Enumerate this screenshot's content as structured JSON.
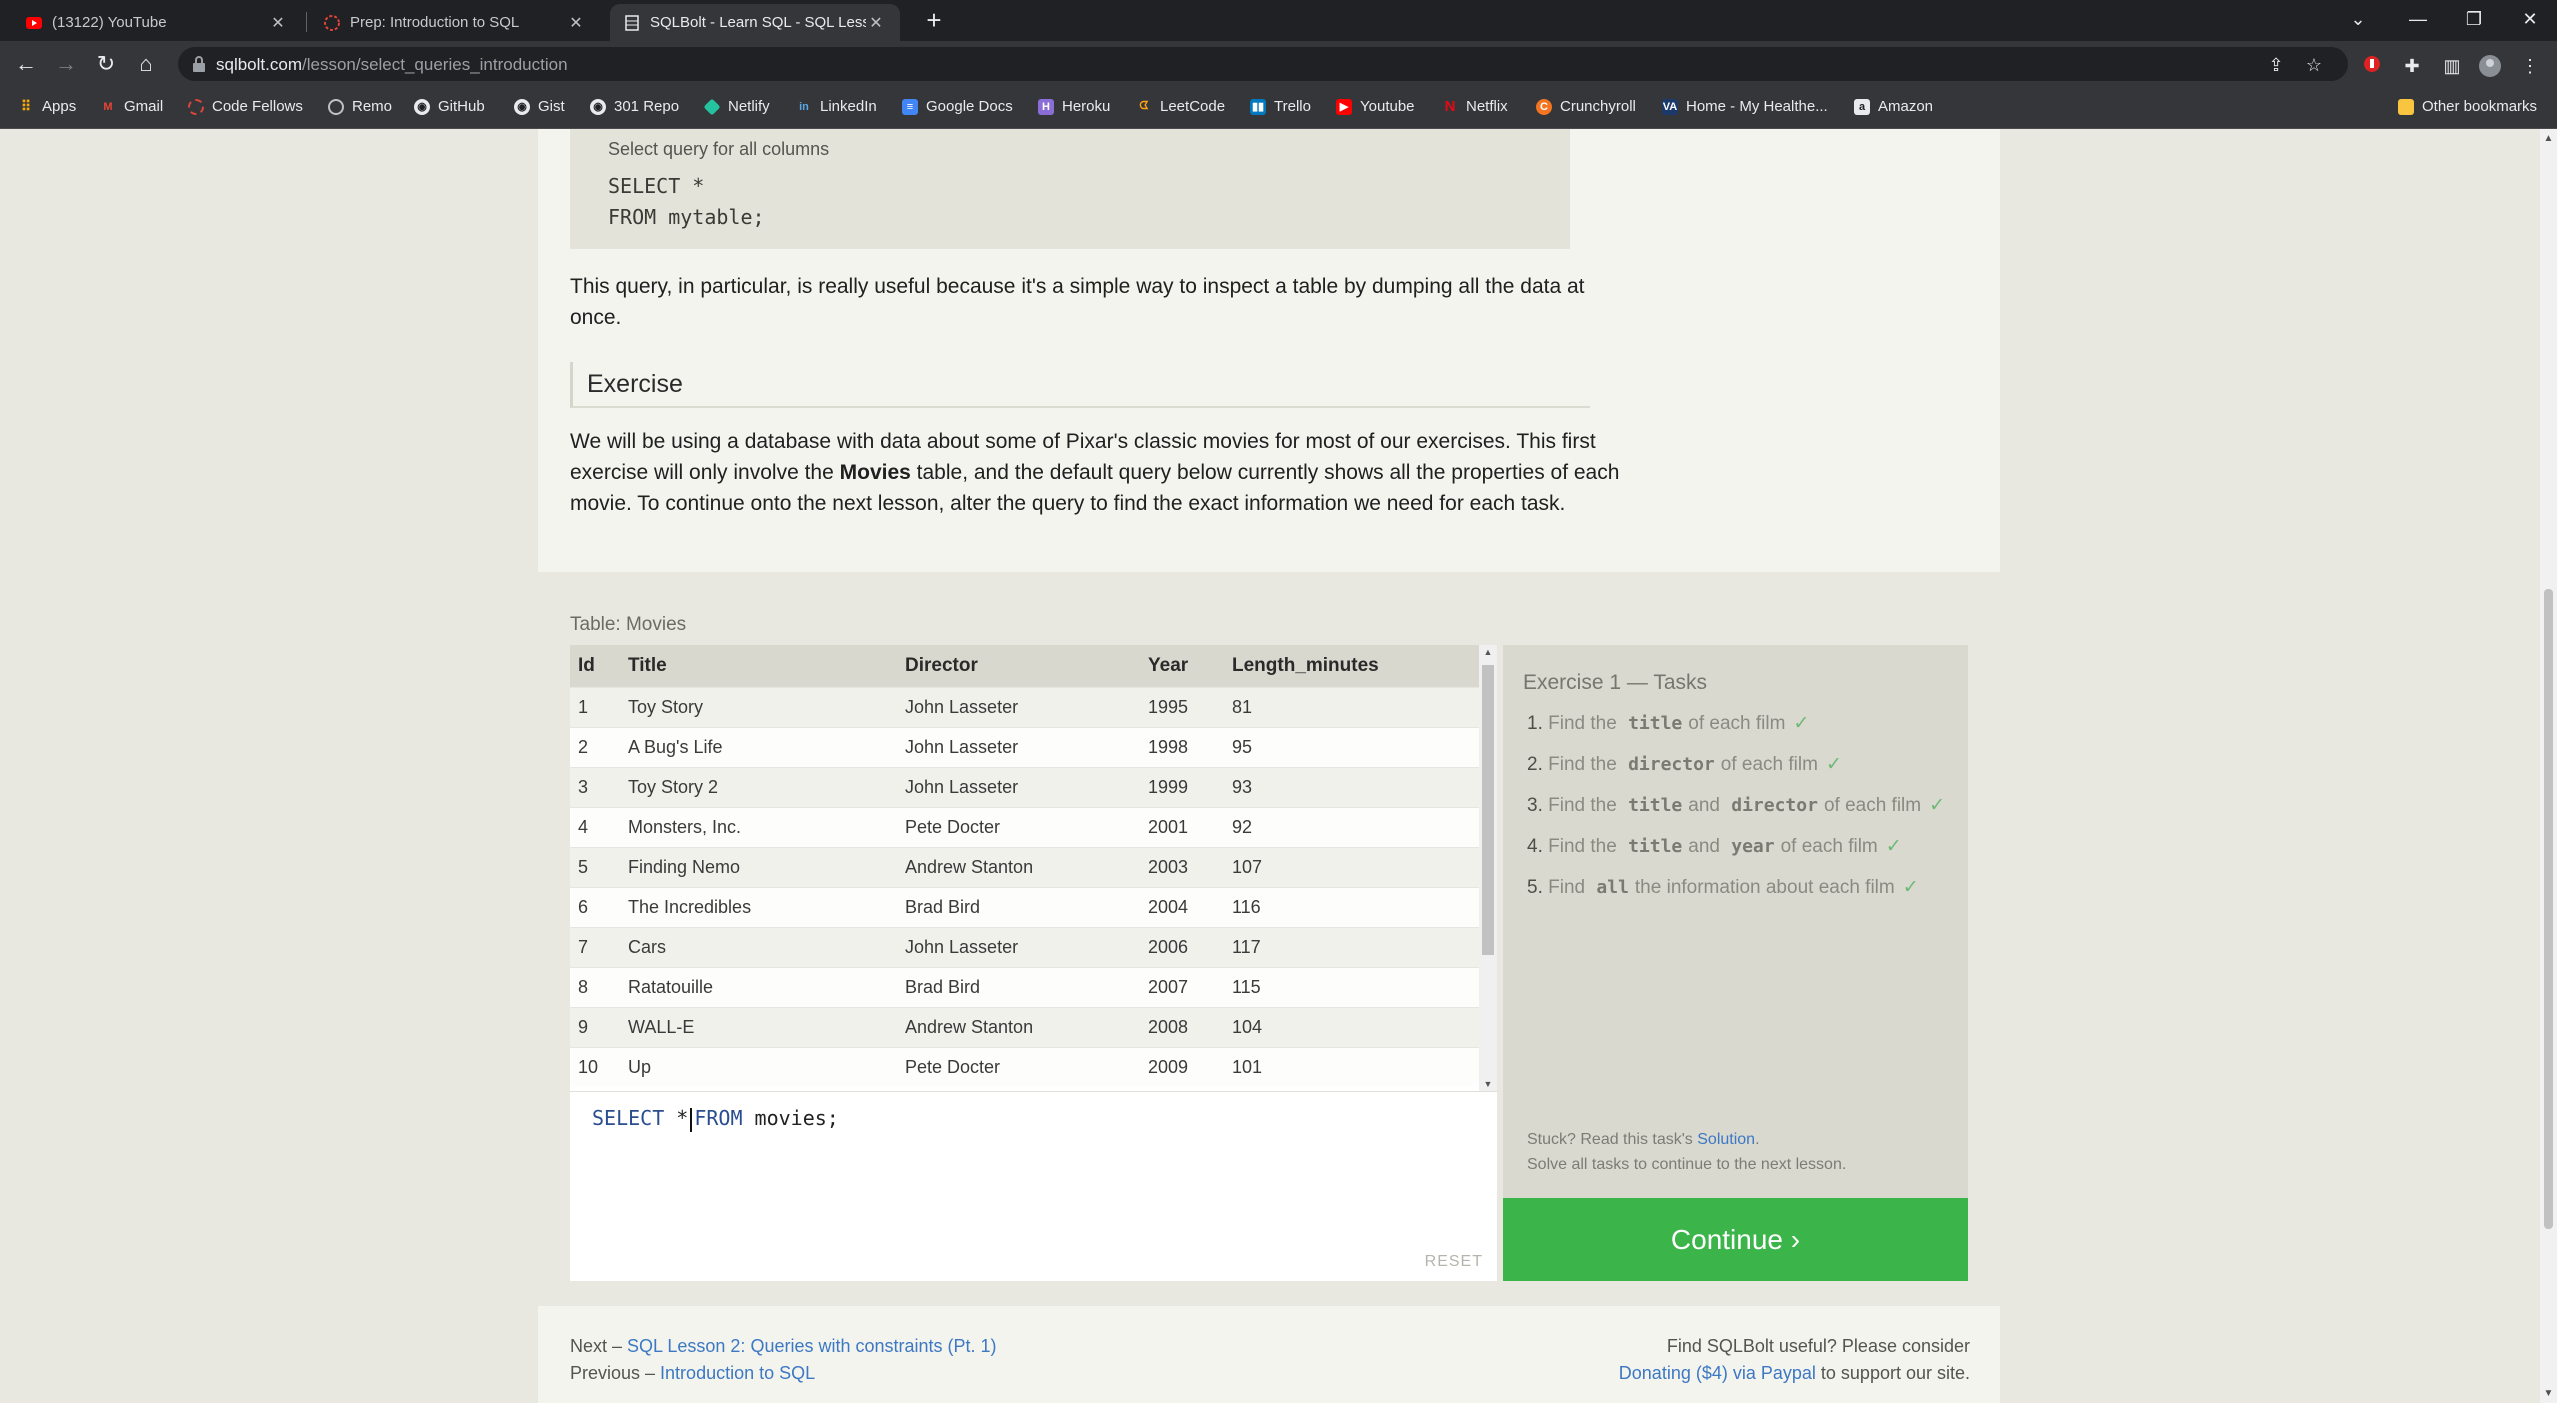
{
  "browser": {
    "tabs": [
      {
        "title": "(13122) YouTube",
        "active": false
      },
      {
        "title": "Prep: Introduction to SQL",
        "active": false
      },
      {
        "title": "SQLBolt - Learn SQL - SQL Lesson",
        "active": true
      }
    ],
    "url_host": "sqlbolt.com",
    "url_path": "/lesson/select_queries_introduction",
    "bookmarks": [
      "Apps",
      "Gmail",
      "Code Fellows",
      "Remo",
      "GitHub",
      "Gist",
      "301 Repo",
      "Netlify",
      "LinkedIn",
      "Google Docs",
      "Heroku",
      "LeetCode",
      "Trello",
      "Youtube",
      "Netflix",
      "Crunchyroll",
      "Home - My Healthe...",
      "Amazon"
    ],
    "other_bookmarks": "Other bookmarks"
  },
  "lesson": {
    "code_caption": "Select query for all columns",
    "code_line1": "SELECT *",
    "code_line2_kw": "FROM ",
    "code_line2_tbl": "mytable;",
    "para1": "This query, in particular, is really useful because it's a simple way to inspect a table by dumping all the data at once.",
    "exercise_heading": "Exercise",
    "para2_a": "We will be using a database with data about some of Pixar's classic movies for most of our exercises. This first exercise will only involve the ",
    "para2_bold": "Movies",
    "para2_b": " table, and the default query below currently shows all the properties of each movie. To continue onto the next lesson, alter the query to find the exact information we need for each task."
  },
  "table": {
    "label": "Table: Movies",
    "columns": [
      "Id",
      "Title",
      "Director",
      "Year",
      "Length_minutes"
    ],
    "rows": [
      [
        "1",
        "Toy Story",
        "John Lasseter",
        "1995",
        "81"
      ],
      [
        "2",
        "A Bug's Life",
        "John Lasseter",
        "1998",
        "95"
      ],
      [
        "3",
        "Toy Story 2",
        "John Lasseter",
        "1999",
        "93"
      ],
      [
        "4",
        "Monsters, Inc.",
        "Pete Docter",
        "2001",
        "92"
      ],
      [
        "5",
        "Finding Nemo",
        "Andrew Stanton",
        "2003",
        "107"
      ],
      [
        "6",
        "The Incredibles",
        "Brad Bird",
        "2004",
        "116"
      ],
      [
        "7",
        "Cars",
        "John Lasseter",
        "2006",
        "117"
      ],
      [
        "8",
        "Ratatouille",
        "Brad Bird",
        "2007",
        "115"
      ],
      [
        "9",
        "WALL-E",
        "Andrew Stanton",
        "2008",
        "104"
      ],
      [
        "10",
        "Up",
        "Pete Docter",
        "2009",
        "101"
      ]
    ]
  },
  "editor": {
    "kw1": "SELECT",
    "star": " *",
    "kw2": "FROM",
    "rest": " movies;",
    "reset": "RESET"
  },
  "tasks": {
    "heading": "Exercise 1 — Tasks",
    "items": [
      {
        "num": "1.",
        "pre": "Find the",
        "code": "title",
        "post": "of each film"
      },
      {
        "num": "2.",
        "pre": "Find the",
        "code": "director",
        "post": "of each film"
      },
      {
        "num": "3.",
        "pre": "Find the",
        "code": "title",
        "mid": "and",
        "code2": "director",
        "post": "of each film"
      },
      {
        "num": "4.",
        "pre": "Find the",
        "code": "title",
        "mid": "and",
        "code2": "year",
        "post": "of each film"
      },
      {
        "num": "5.",
        "pre": "Find",
        "code": "all",
        "post": "the information about each film"
      }
    ],
    "check": "✓",
    "stuck_pre": "Stuck? Read this task's ",
    "stuck_link": "Solution",
    "stuck_post": ".",
    "solve_all": "Solve all tasks to continue to the next lesson.",
    "continue": "Continue ›"
  },
  "footer": {
    "next_pre": "Next – ",
    "next_link": "SQL Lesson 2: Queries with constraints (Pt. 1)",
    "prev_pre": "Previous – ",
    "prev_link": "Introduction to SQL",
    "useful": "Find SQLBolt useful? Please consider",
    "donate_link": "Donating ($4) via Paypal",
    "donate_post": " to support our site."
  },
  "colors": {
    "continue": "#3bb54a",
    "link": "#3c78c3",
    "check": "#6fb977"
  }
}
